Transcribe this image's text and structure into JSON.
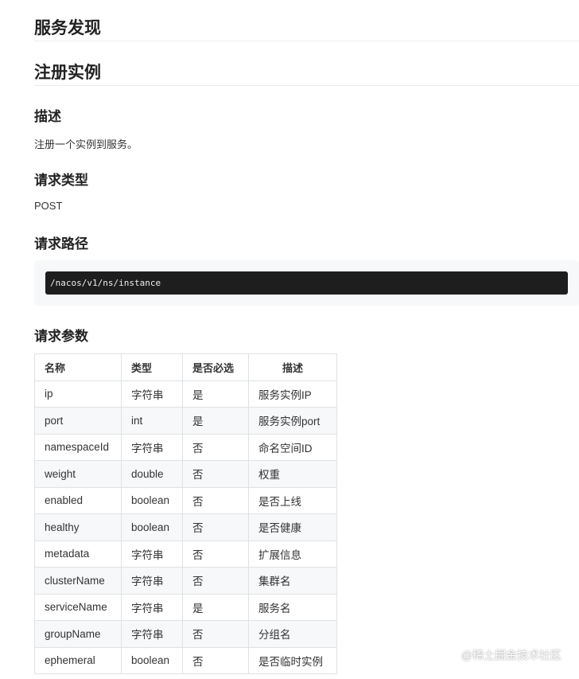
{
  "h1_service": "服务发现",
  "h1_register": "注册实例",
  "desc_heading": "描述",
  "desc_text": "注册一个实例到服务。",
  "type_heading": "请求类型",
  "type_text": "POST",
  "path_heading": "请求路径",
  "path_code": "/nacos/v1/ns/instance",
  "params_heading": "请求参数",
  "table": {
    "headers": [
      "名称",
      "类型",
      "是否必选",
      "描述"
    ],
    "rows": [
      [
        "ip",
        "字符串",
        "是",
        "服务实例IP"
      ],
      [
        "port",
        "int",
        "是",
        "服务实例port"
      ],
      [
        "namespaceId",
        "字符串",
        "否",
        "命名空间ID"
      ],
      [
        "weight",
        "double",
        "否",
        "权重"
      ],
      [
        "enabled",
        "boolean",
        "否",
        "是否上线"
      ],
      [
        "healthy",
        "boolean",
        "否",
        "是否健康"
      ],
      [
        "metadata",
        "字符串",
        "否",
        "扩展信息"
      ],
      [
        "clusterName",
        "字符串",
        "否",
        "集群名"
      ],
      [
        "serviceName",
        "字符串",
        "是",
        "服务名"
      ],
      [
        "groupName",
        "字符串",
        "否",
        "分组名"
      ],
      [
        "ephemeral",
        "boolean",
        "否",
        "是否临时实例"
      ]
    ]
  },
  "watermark": "@稀土掘金技术社区"
}
